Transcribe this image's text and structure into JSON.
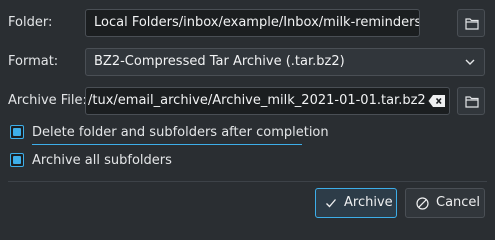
{
  "folder": {
    "label": "Folder:",
    "value": "Local  Folders/inbox/example/Inbox/milk-reminders"
  },
  "format": {
    "label": "Format:",
    "selected": "BZ2-Compressed Tar Archive (.tar.bz2)"
  },
  "archive_file": {
    "label": "Archive File:",
    "value": "/tux/email_archive/Archive_milk_2021-01-01.tar.bz2"
  },
  "options": {
    "delete_folder": {
      "label": "Delete folder and subfolders after completion",
      "checked": true
    },
    "archive_subfolders": {
      "label": "Archive all subfolders",
      "checked": true
    }
  },
  "buttons": {
    "archive": "Archive",
    "cancel": "Cancel"
  },
  "colors": {
    "background": "#2a2e32",
    "accent": "#3daee9",
    "field": "#1b1e20"
  },
  "icons": {
    "folder_browse": "folder-open-icon",
    "combo": "chevron-down-icon",
    "clear": "clear-text-icon",
    "archive": "checkmark-icon",
    "cancel": "cancel-icon"
  }
}
